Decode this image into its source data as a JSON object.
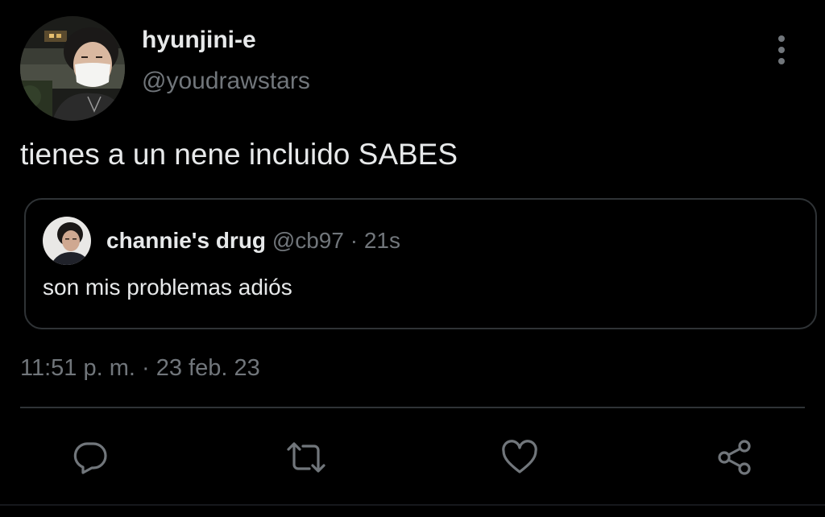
{
  "tweet": {
    "author": {
      "display_name": "hyunjini-e",
      "handle": "@youdrawstars"
    },
    "text": "tienes a un nene incluido SABES",
    "quoted": {
      "display_name": "channie's drug",
      "handle": "@cb97",
      "separator": "·",
      "time": "21s",
      "text": "son mis problemas adiós"
    },
    "timestamp": "11:51 p. m. · 23 feb. 23"
  },
  "actions": {
    "reply_icon": "reply-icon",
    "retweet_icon": "retweet-icon",
    "like_icon": "heart-icon",
    "share_icon": "share-icon",
    "more_icon": "more-vertical-icon"
  },
  "colors": {
    "background": "#000000",
    "text_primary": "#e7e9ea",
    "text_secondary": "#71767b",
    "border": "#2f3336",
    "icon": "#71767b"
  }
}
